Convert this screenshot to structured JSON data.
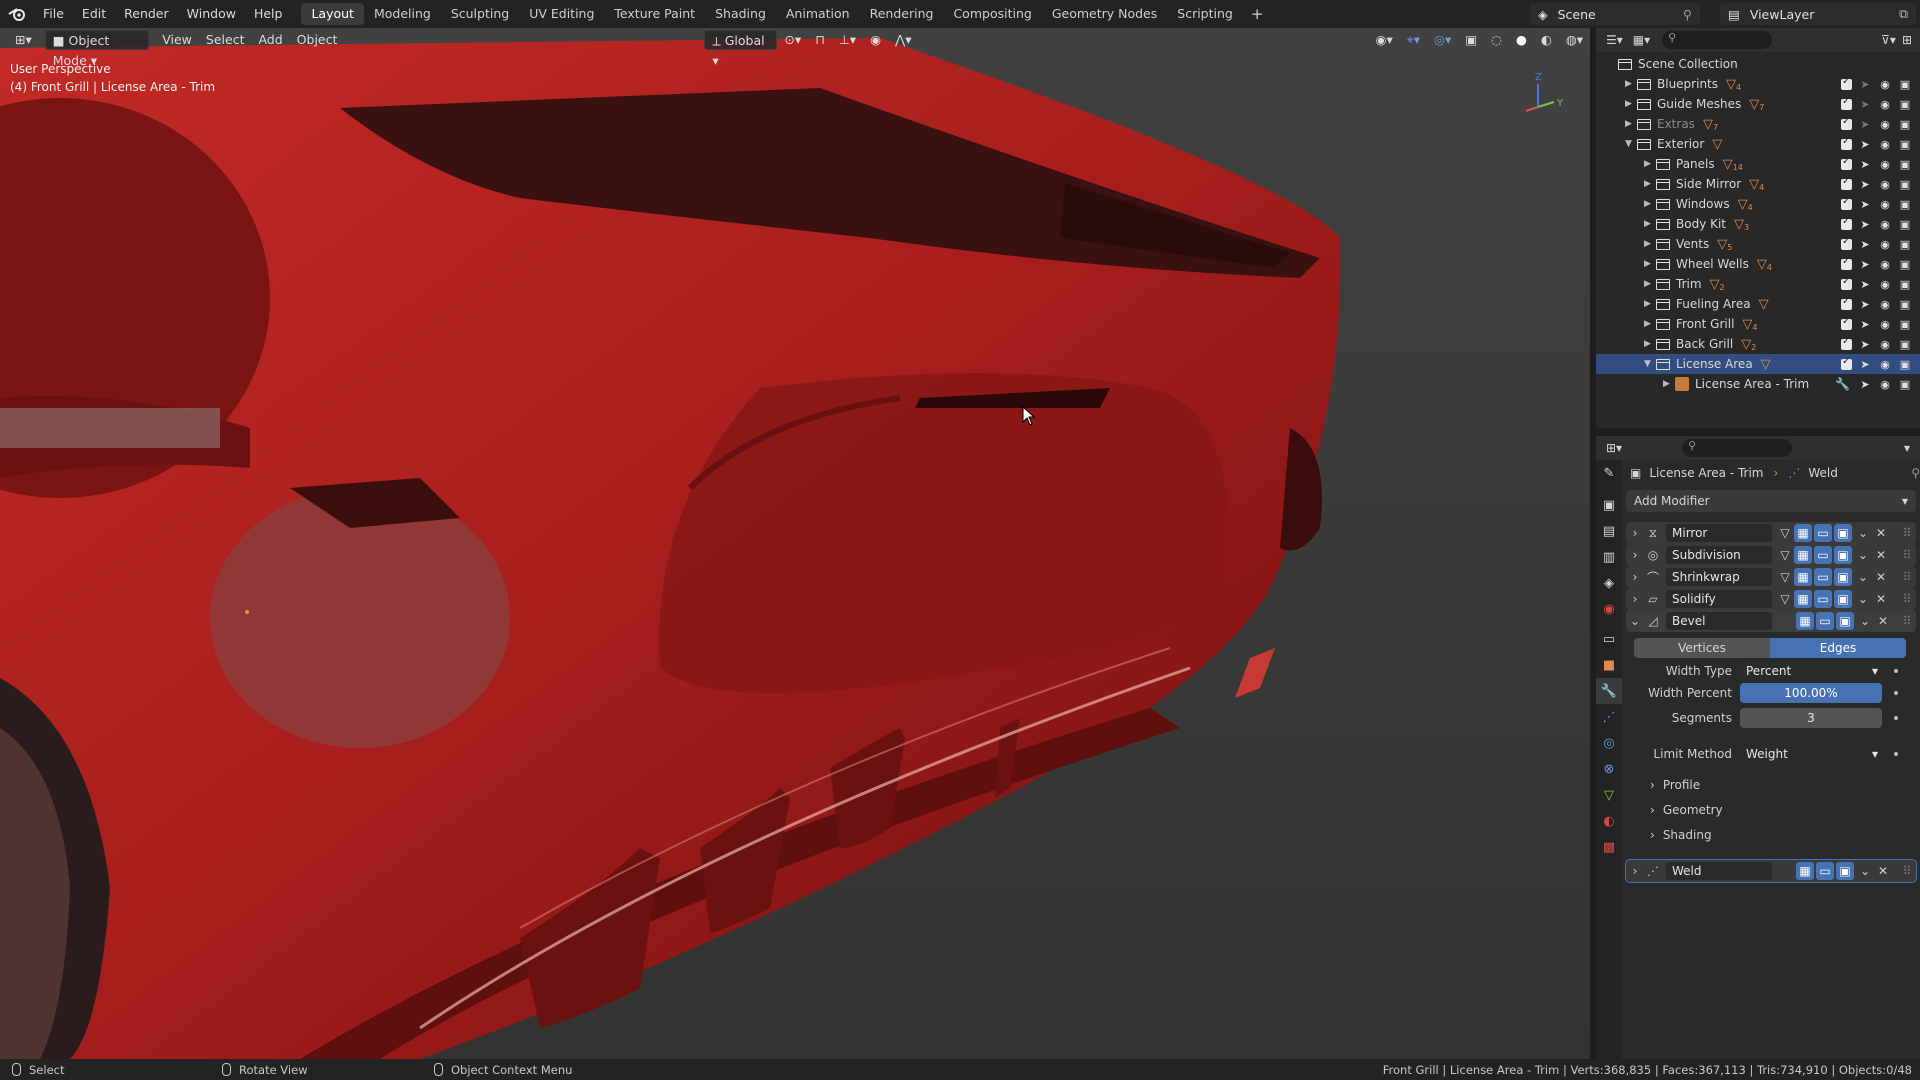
{
  "topbar": {
    "menus": [
      "File",
      "Edit",
      "Render",
      "Window",
      "Help"
    ],
    "workspaces": [
      "Layout",
      "Modeling",
      "Sculpting",
      "UV Editing",
      "Texture Paint",
      "Shading",
      "Animation",
      "Rendering",
      "Compositing",
      "Geometry Nodes",
      "Scripting"
    ],
    "active_workspace": "Layout",
    "scene": "Scene",
    "view_layer": "ViewLayer"
  },
  "viewport": {
    "mode": "Object Mode",
    "menus": [
      "View",
      "Select",
      "Add",
      "Object"
    ],
    "orientation": "Global",
    "info_line1": "User Perspective",
    "info_line2": "(4) Front Grill | License Area - Trim",
    "gizmo_axes": [
      "Z",
      "Y"
    ]
  },
  "outliner": {
    "root": "Scene Collection",
    "items": [
      {
        "label": "Blueprints",
        "count": "4",
        "level": 1,
        "expanded": false
      },
      {
        "label": "Guide Meshes",
        "count": "7",
        "level": 1,
        "expanded": false
      },
      {
        "label": "Extras",
        "count": "7",
        "level": 1,
        "expanded": false,
        "dim": true
      },
      {
        "label": "Exterior",
        "count": "",
        "level": 1,
        "expanded": true
      },
      {
        "label": "Panels",
        "count": "14",
        "level": 2,
        "expanded": false
      },
      {
        "label": "Side Mirror",
        "count": "4",
        "level": 2,
        "expanded": false
      },
      {
        "label": "Windows",
        "count": "4",
        "level": 2,
        "expanded": false
      },
      {
        "label": "Body Kit",
        "count": "3",
        "level": 2,
        "expanded": false
      },
      {
        "label": "Vents",
        "count": "5",
        "level": 2,
        "expanded": false
      },
      {
        "label": "Wheel Wells",
        "count": "4",
        "level": 2,
        "expanded": false
      },
      {
        "label": "Trim",
        "count": "2",
        "level": 2,
        "expanded": false
      },
      {
        "label": "Fueling Area",
        "count": "",
        "level": 2,
        "expanded": false
      },
      {
        "label": "Front Grill",
        "count": "4",
        "level": 2,
        "expanded": false
      },
      {
        "label": "Back Grill",
        "count": "2",
        "level": 2,
        "expanded": false
      },
      {
        "label": "License Area",
        "count": "",
        "level": 2,
        "expanded": true,
        "selected": true
      },
      {
        "label": "License Area - Trim",
        "count": "",
        "level": 3,
        "expanded": false,
        "object": true
      }
    ]
  },
  "properties": {
    "object_name": "License Area - Trim",
    "modifier_crumb": "Weld",
    "add_modifier": "Add Modifier",
    "modifiers": [
      "Mirror",
      "Subdivision",
      "Shrinkwrap",
      "Solidify",
      "Bevel",
      "Weld"
    ],
    "bevel": {
      "tabs": [
        "Vertices",
        "Edges"
      ],
      "active_tab": "Edges",
      "width_type_label": "Width Type",
      "width_type_value": "Percent",
      "width_percent_label": "Width Percent",
      "width_percent_value": "100.00%",
      "segments_label": "Segments",
      "segments_value": "3",
      "limit_method_label": "Limit Method",
      "limit_method_value": "Weight",
      "subpanels": [
        "Profile",
        "Geometry",
        "Shading"
      ]
    }
  },
  "statusbar": {
    "left_action": "Select",
    "middle_action": "Rotate View",
    "right_action": "Object Context Menu",
    "stats": "Front Grill | License Area - Trim | Verts:368,835 | Faces:367,113 | Tris:734,910 | Objects:0/48"
  },
  "colors": {
    "accent": "#4772b3",
    "selected_row": "#334d80",
    "car_red": "#b3211f"
  }
}
